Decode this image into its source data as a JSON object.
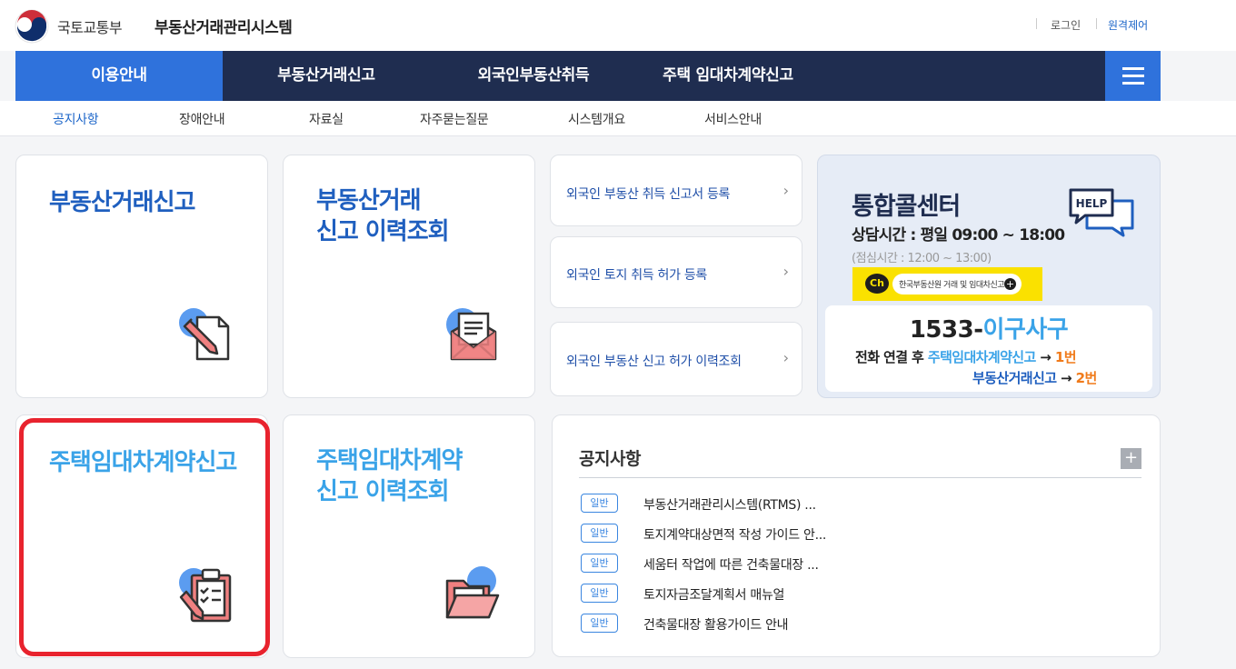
{
  "header": {
    "ministry": "국토교통부",
    "system_name": "부동산거래관리시스템",
    "util": {
      "login": "로그인",
      "remote": "원격제어"
    }
  },
  "gnb": {
    "items": [
      {
        "label": "이용안내",
        "active": true
      },
      {
        "label": "부동산거래신고"
      },
      {
        "label": "외국인부동산취득"
      },
      {
        "label": "주택 임대차계약신고"
      }
    ],
    "menu_icon": "hamburger-icon"
  },
  "lnb": {
    "items": [
      {
        "label": "공지사항",
        "active": true
      },
      {
        "label": "장애안내"
      },
      {
        "label": "자료실"
      },
      {
        "label": "자주묻는질문"
      },
      {
        "label": "시스템개요"
      },
      {
        "label": "서비스안내"
      }
    ]
  },
  "cards": {
    "realestate_report": {
      "title": "부동산거래신고",
      "icon": "document-pen-icon"
    },
    "realestate_history": {
      "title_line1": "부동산거래",
      "title_line2": "신고 이력조회",
      "icon": "envelope-letter-icon"
    },
    "lease_report": {
      "title": "주택임대차계약신고",
      "icon": "clipboard-checklist-icon"
    },
    "lease_history": {
      "title_line1": "주택임대차계약",
      "title_line2": "신고 이력조회",
      "icon": "folder-open-icon"
    }
  },
  "foreign_links": [
    {
      "label": "외국인 부동산 취득 신고서 등록"
    },
    {
      "label": "외국인 토지 취득 허가 등록"
    },
    {
      "label": "외국인 부동산 신고 허가 이력조회"
    }
  ],
  "callcenter": {
    "title": "통합콜센터",
    "hours": "상담시간 : 평일 09:00 ~ 18:00",
    "lunch": "(점심시간 : 12:00 ~ 13:00)",
    "kakao_badge": "Ch",
    "kakao_text": "한국부동산원 거래 및 임대차신고",
    "help_label": "HELP",
    "number_prefix": "1533-",
    "number_word": "이구사구",
    "line1_prefix": "전화 연결 후 ",
    "line1_service": "주택임대차계약신고",
    "line1_arrow": " → ",
    "line1_key": "1번",
    "line2_service": "부동산거래신고",
    "line2_arrow": " → ",
    "line2_key": "2번"
  },
  "notice": {
    "title": "공지사항",
    "more": "+",
    "items": [
      {
        "badge": "일반",
        "text": "부동산거래관리시스템(RTMS) ..."
      },
      {
        "badge": "일반",
        "text": "토지계약대상면적 작성 가이드 안..."
      },
      {
        "badge": "일반",
        "text": "세움터 작업에 따른 건축물대장 ..."
      },
      {
        "badge": "일반",
        "text": "토지자금조달계획서 매뉴얼"
      },
      {
        "badge": "일반",
        "text": "건축물대장 활용가이드 안내"
      }
    ]
  },
  "colors": {
    "navy": "#1f2d50",
    "accent_blue": "#2f72dc",
    "link_blue": "#1f5fbf",
    "light_blue": "#3aa3e8",
    "orange": "#f07a1a",
    "highlight_red": "#e8232e",
    "kakao_yellow": "#fae100"
  }
}
